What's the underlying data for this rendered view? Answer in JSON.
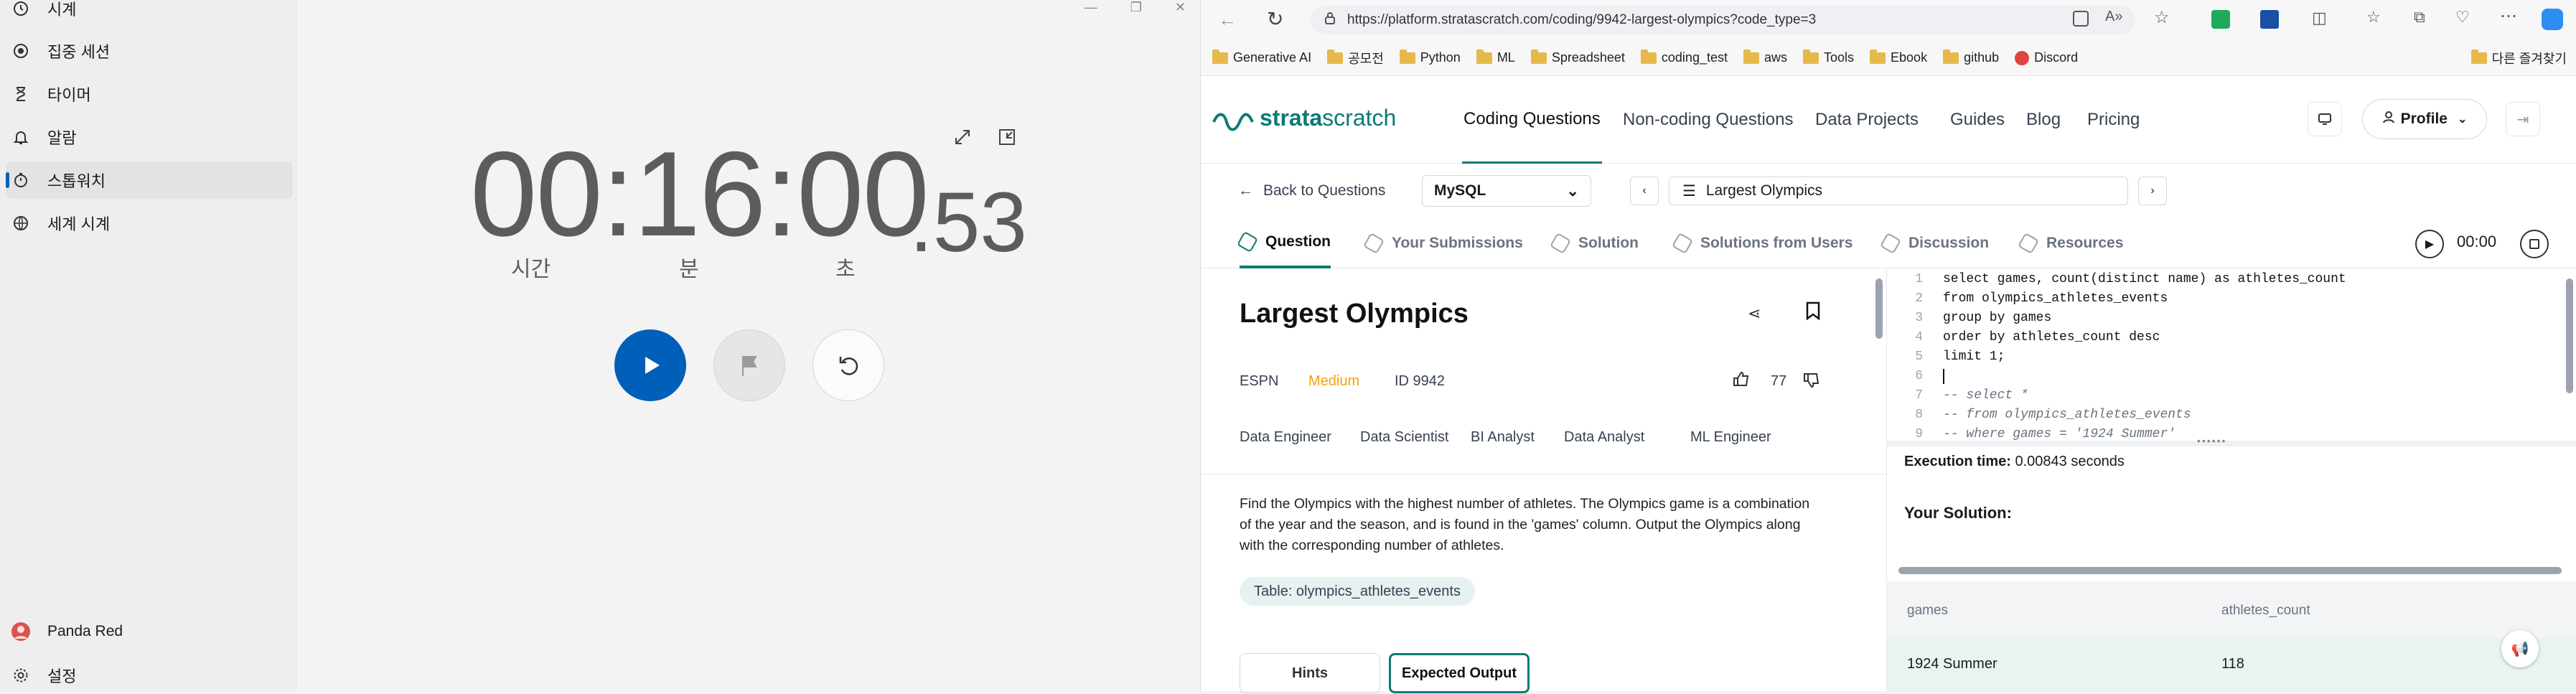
{
  "clock": {
    "sidebar": [
      {
        "label": "시계",
        "icon": "clock-icon"
      },
      {
        "label": "집중 세션",
        "icon": "focus-icon"
      },
      {
        "label": "타이머",
        "icon": "hourglass-icon"
      },
      {
        "label": "알람",
        "icon": "bell-icon"
      },
      {
        "label": "스톱워치",
        "icon": "stopwatch-icon",
        "active": true
      },
      {
        "label": "세계 시계",
        "icon": "globe-icon"
      }
    ],
    "user": "Panda Red",
    "settings": "설정",
    "stopwatch": {
      "main": "00:16:00",
      "fraction": ".53",
      "units": {
        "hours": "시간",
        "minutes": "분",
        "seconds": "초"
      }
    },
    "accent": "#005fb8"
  },
  "browser": {
    "url": "https://platform.stratascratch.com/coding/9942-largest-olympics?code_type=3",
    "bookmarks": [
      "Generative AI",
      "공모전",
      "Python",
      "ML",
      "Spreadsheet",
      "coding_test",
      "aws",
      "Tools",
      "Ebook",
      "github",
      "Discord"
    ],
    "other_bookmarks": "다른 즐겨찾기"
  },
  "site": {
    "logo_a": "strata",
    "logo_b": "scratch",
    "nav": [
      "Coding Questions",
      "Non-coding Questions",
      "Data Projects",
      "Guides",
      "Blog",
      "Pricing"
    ],
    "profile": "Profile",
    "back": "Back to Questions",
    "language": "MySQL",
    "question_name": "Largest Olympics",
    "timer": "00:00",
    "tabs": [
      "Question",
      "Your Submissions",
      "Solution",
      "Solutions from Users",
      "Discussion",
      "Resources"
    ],
    "accent": "#0b7a75"
  },
  "question": {
    "title": "Largest Olympics",
    "company": "ESPN",
    "difficulty": "Medium",
    "id": "ID 9942",
    "likes": "77",
    "roles": [
      "Data Engineer",
      "Data Scientist",
      "BI Analyst",
      "Data Analyst",
      "ML Engineer"
    ],
    "description": "Find the Olympics with the highest number of athletes. The Olympics game is a combination of the year and the season, and is found in the 'games' column. Output the Olympics along with the corresponding number of athletes.",
    "table": "Table: olympics_athletes_events",
    "buttons": {
      "hints": "Hints",
      "expected": "Expected Output"
    }
  },
  "editor": {
    "lines": [
      {
        "n": "1",
        "text": "select games, count(distinct name) as athletes_count"
      },
      {
        "n": "2",
        "text": "from olympics_athletes_events"
      },
      {
        "n": "3",
        "text": "group by games"
      },
      {
        "n": "4",
        "text": "order by athletes_count desc"
      },
      {
        "n": "5",
        "text": "limit 1;"
      },
      {
        "n": "6",
        "text": ""
      },
      {
        "n": "7",
        "text": "-- select *"
      },
      {
        "n": "8",
        "text": "-- from olympics_athletes_events"
      },
      {
        "n": "9",
        "text": "-- where games = '1924 Summer'"
      }
    ]
  },
  "results": {
    "exec_label": "Execution time:",
    "exec_value": "0.00843 seconds",
    "solution_heading": "Your Solution:",
    "columns": [
      "games",
      "athletes_count"
    ],
    "rows": [
      [
        "1924 Summer",
        "118"
      ]
    ]
  }
}
